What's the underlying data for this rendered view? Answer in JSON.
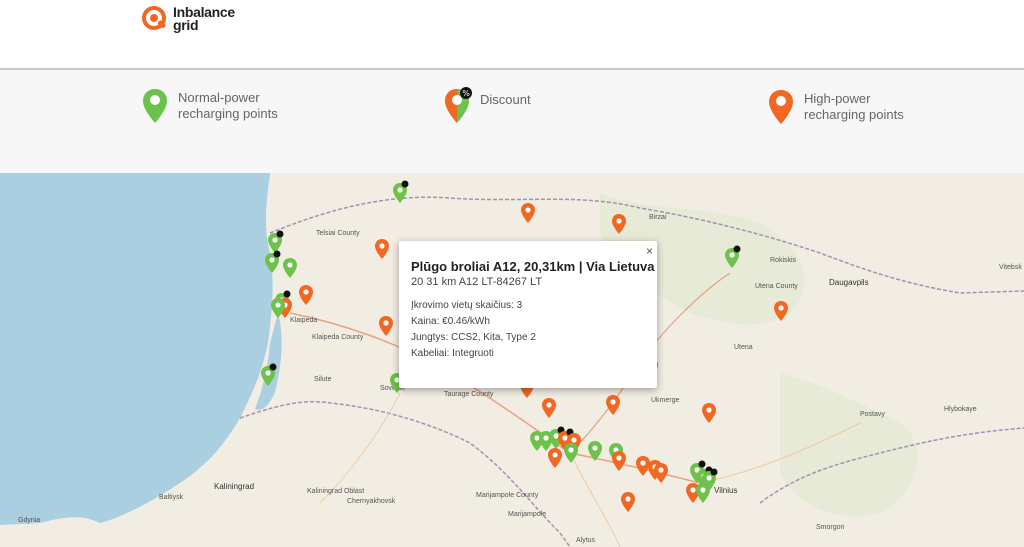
{
  "header": {
    "logo_line1": "Inbalance",
    "logo_line2": "grid",
    "brand_color": "#f26722"
  },
  "legend": {
    "normal_label_1": "Normal-power",
    "normal_label_2": "recharging points",
    "discount_label": "Discount",
    "high_label_1": "High-power",
    "high_label_2": "recharging points",
    "normal_color": "#6cc24a",
    "high_color": "#f26722"
  },
  "popup": {
    "close": "×",
    "title": "Plūgo broliai A12, 20,31km | Via Lietuva",
    "subtitle": "20 31 km A12 LT-84267 LT",
    "rows": [
      "Įkrovimo vietų skaičius: 3",
      "Kaina: €0.46/kWh",
      "Jungtys: CCS2, Kita, Type 2",
      "Kabeliai: Integruoti"
    ]
  },
  "map_labels": {
    "kaliningrad": "Kaliningrad",
    "daugavpils": "Daugavpils",
    "utena": "Utena",
    "postavy": "Postavy",
    "hlybokaye": "Hlybokaye",
    "smorgon": "Smorgon",
    "vitebsk": "Vitebsk",
    "alytus": "Alytus",
    "marijampole": "Marijampole",
    "chernyakhovsk": "Chernyakhovsk",
    "gdynia": "Gdynia",
    "baltiysk": "Baltiysk",
    "birzai": "Birzai",
    "klaipeda": "Klaipeda County",
    "taurage": "Taurage County",
    "telsiai": "Telsiai County",
    "utena_county": "Utena County",
    "kaliningrad_oblast": "Kaliningrad Oblast",
    "siluté": "Silute",
    "ukmerge": "Ukmerge",
    "vilnius": "Vilnius",
    "kaipeda": "Klaipeda",
    "marijampole_county": "Marijampole County",
    "sovetsk": "Sovetsk",
    "rokiskis": "Rokiskis"
  }
}
